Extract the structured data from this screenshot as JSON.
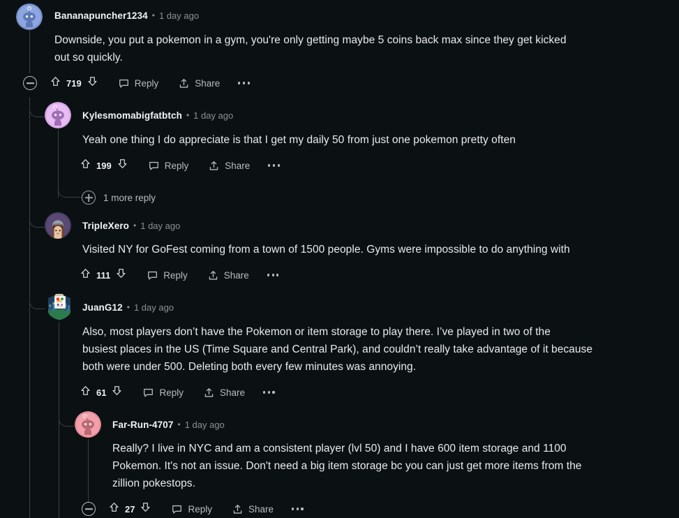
{
  "theme": {
    "background": "#0b1113",
    "text_primary": "#e9ebec",
    "text_muted": "#8a9094",
    "action_color": "#b6bcbf",
    "thread_line": "#3a4043"
  },
  "labels": {
    "reply": "Reply",
    "share": "Share",
    "separator": "•",
    "more_reply": "1 more reply"
  },
  "comments": [
    {
      "id": "c1",
      "author": "Bananapuncher1234",
      "age": "1 day ago",
      "body": "Downside, you put a pokemon in a gym, you're only getting maybe 5 coins back max since they get kicked\nout so quickly.",
      "score": "719",
      "has_collapse": true,
      "avatar": "snoo-blue"
    },
    {
      "id": "c2",
      "author": "Kylesmomabigfatbtch",
      "age": "1 day ago",
      "body": "Yeah one thing I do appreciate is that I get my daily 50 from just one pokemon pretty often",
      "score": "199",
      "has_collapse": false,
      "avatar": "snoo-purple"
    },
    {
      "id": "c3",
      "author": "TripleXero",
      "age": "1 day ago",
      "body": "Visited NY for GoFest coming from a town of 1500 people. Gyms were impossible to do anything with",
      "score": "111",
      "has_collapse": false,
      "avatar": "character-brownhair"
    },
    {
      "id": "c4",
      "author": "JuanG12",
      "age": "1 day ago",
      "body": "Also, most players don’t have the Pokemon or item storage to play there. I’ve played in two of the\nbusiest places in the US (Time Square and Central Park), and couldn’t really take advantage of it because\nboth were under 500. Deleting both every few minutes was annoying.",
      "score": "61",
      "has_collapse": false,
      "avatar": "badge-colorful"
    },
    {
      "id": "c5",
      "author": "Far-Run-4707",
      "age": "1 day ago",
      "body": "Really? I live in NYC and am a consistent player (lvl 50) and I have 600 item storage and 1100\nPokemon. It's not an issue. Don't need a big item storage bc you can just get more items from the\nzillion pokestops.",
      "score": "27",
      "has_collapse": true,
      "avatar": "snoo-pink"
    }
  ]
}
